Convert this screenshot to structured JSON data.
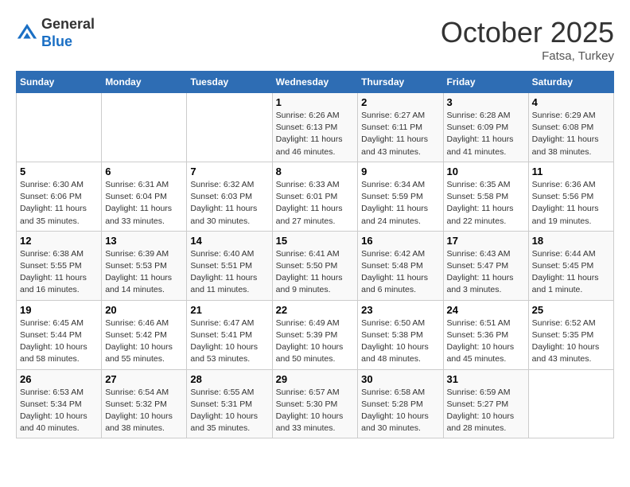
{
  "header": {
    "logo_line1": "General",
    "logo_line2": "Blue",
    "month": "October 2025",
    "location": "Fatsa, Turkey"
  },
  "columns": [
    "Sunday",
    "Monday",
    "Tuesday",
    "Wednesday",
    "Thursday",
    "Friday",
    "Saturday"
  ],
  "weeks": [
    [
      {
        "day": "",
        "info": ""
      },
      {
        "day": "",
        "info": ""
      },
      {
        "day": "",
        "info": ""
      },
      {
        "day": "1",
        "info": "Sunrise: 6:26 AM\nSunset: 6:13 PM\nDaylight: 11 hours and 46 minutes."
      },
      {
        "day": "2",
        "info": "Sunrise: 6:27 AM\nSunset: 6:11 PM\nDaylight: 11 hours and 43 minutes."
      },
      {
        "day": "3",
        "info": "Sunrise: 6:28 AM\nSunset: 6:09 PM\nDaylight: 11 hours and 41 minutes."
      },
      {
        "day": "4",
        "info": "Sunrise: 6:29 AM\nSunset: 6:08 PM\nDaylight: 11 hours and 38 minutes."
      }
    ],
    [
      {
        "day": "5",
        "info": "Sunrise: 6:30 AM\nSunset: 6:06 PM\nDaylight: 11 hours and 35 minutes."
      },
      {
        "day": "6",
        "info": "Sunrise: 6:31 AM\nSunset: 6:04 PM\nDaylight: 11 hours and 33 minutes."
      },
      {
        "day": "7",
        "info": "Sunrise: 6:32 AM\nSunset: 6:03 PM\nDaylight: 11 hours and 30 minutes."
      },
      {
        "day": "8",
        "info": "Sunrise: 6:33 AM\nSunset: 6:01 PM\nDaylight: 11 hours and 27 minutes."
      },
      {
        "day": "9",
        "info": "Sunrise: 6:34 AM\nSunset: 5:59 PM\nDaylight: 11 hours and 24 minutes."
      },
      {
        "day": "10",
        "info": "Sunrise: 6:35 AM\nSunset: 5:58 PM\nDaylight: 11 hours and 22 minutes."
      },
      {
        "day": "11",
        "info": "Sunrise: 6:36 AM\nSunset: 5:56 PM\nDaylight: 11 hours and 19 minutes."
      }
    ],
    [
      {
        "day": "12",
        "info": "Sunrise: 6:38 AM\nSunset: 5:55 PM\nDaylight: 11 hours and 16 minutes."
      },
      {
        "day": "13",
        "info": "Sunrise: 6:39 AM\nSunset: 5:53 PM\nDaylight: 11 hours and 14 minutes."
      },
      {
        "day": "14",
        "info": "Sunrise: 6:40 AM\nSunset: 5:51 PM\nDaylight: 11 hours and 11 minutes."
      },
      {
        "day": "15",
        "info": "Sunrise: 6:41 AM\nSunset: 5:50 PM\nDaylight: 11 hours and 9 minutes."
      },
      {
        "day": "16",
        "info": "Sunrise: 6:42 AM\nSunset: 5:48 PM\nDaylight: 11 hours and 6 minutes."
      },
      {
        "day": "17",
        "info": "Sunrise: 6:43 AM\nSunset: 5:47 PM\nDaylight: 11 hours and 3 minutes."
      },
      {
        "day": "18",
        "info": "Sunrise: 6:44 AM\nSunset: 5:45 PM\nDaylight: 11 hours and 1 minute."
      }
    ],
    [
      {
        "day": "19",
        "info": "Sunrise: 6:45 AM\nSunset: 5:44 PM\nDaylight: 10 hours and 58 minutes."
      },
      {
        "day": "20",
        "info": "Sunrise: 6:46 AM\nSunset: 5:42 PM\nDaylight: 10 hours and 55 minutes."
      },
      {
        "day": "21",
        "info": "Sunrise: 6:47 AM\nSunset: 5:41 PM\nDaylight: 10 hours and 53 minutes."
      },
      {
        "day": "22",
        "info": "Sunrise: 6:49 AM\nSunset: 5:39 PM\nDaylight: 10 hours and 50 minutes."
      },
      {
        "day": "23",
        "info": "Sunrise: 6:50 AM\nSunset: 5:38 PM\nDaylight: 10 hours and 48 minutes."
      },
      {
        "day": "24",
        "info": "Sunrise: 6:51 AM\nSunset: 5:36 PM\nDaylight: 10 hours and 45 minutes."
      },
      {
        "day": "25",
        "info": "Sunrise: 6:52 AM\nSunset: 5:35 PM\nDaylight: 10 hours and 43 minutes."
      }
    ],
    [
      {
        "day": "26",
        "info": "Sunrise: 6:53 AM\nSunset: 5:34 PM\nDaylight: 10 hours and 40 minutes."
      },
      {
        "day": "27",
        "info": "Sunrise: 6:54 AM\nSunset: 5:32 PM\nDaylight: 10 hours and 38 minutes."
      },
      {
        "day": "28",
        "info": "Sunrise: 6:55 AM\nSunset: 5:31 PM\nDaylight: 10 hours and 35 minutes."
      },
      {
        "day": "29",
        "info": "Sunrise: 6:57 AM\nSunset: 5:30 PM\nDaylight: 10 hours and 33 minutes."
      },
      {
        "day": "30",
        "info": "Sunrise: 6:58 AM\nSunset: 5:28 PM\nDaylight: 10 hours and 30 minutes."
      },
      {
        "day": "31",
        "info": "Sunrise: 6:59 AM\nSunset: 5:27 PM\nDaylight: 10 hours and 28 minutes."
      },
      {
        "day": "",
        "info": ""
      }
    ]
  ]
}
